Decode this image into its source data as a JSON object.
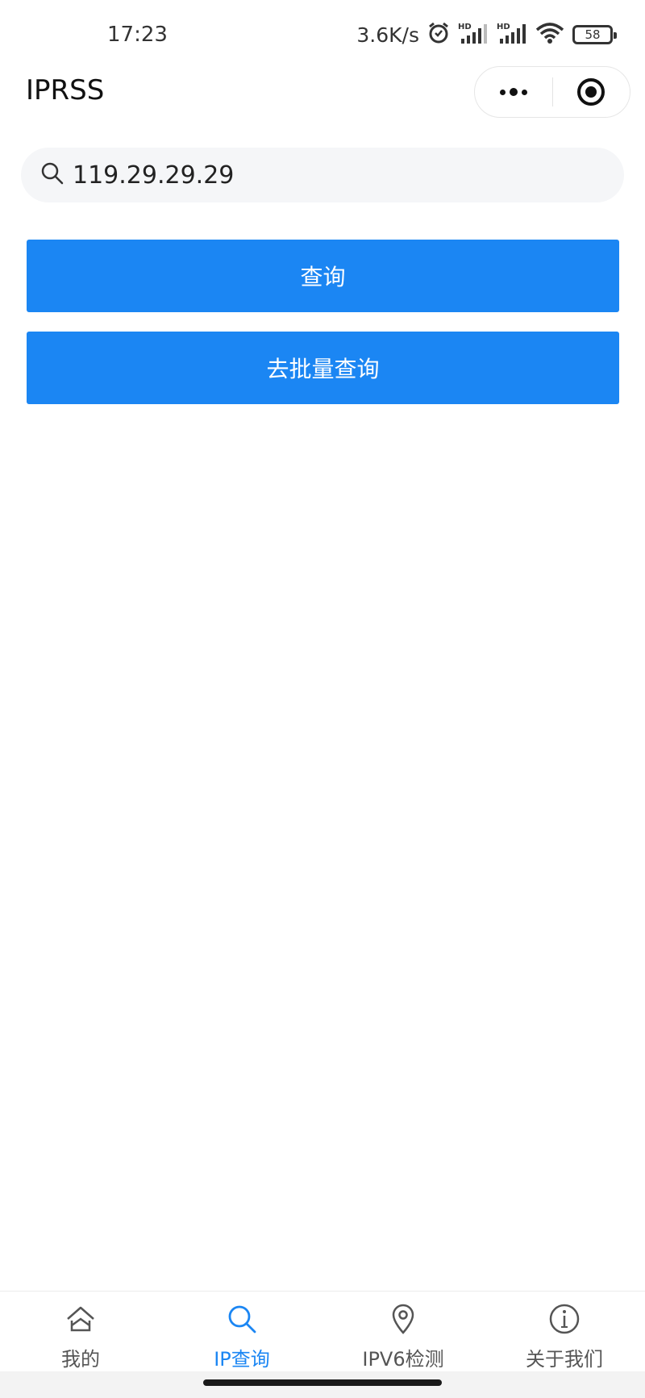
{
  "status_bar": {
    "time": "17:23",
    "speed": "3.6K/s",
    "battery": "58",
    "icons": [
      "alarm-icon",
      "hd-signal-icon",
      "hd-signal-icon",
      "wifi-icon",
      "battery-icon"
    ]
  },
  "nav": {
    "title": "IPRSS"
  },
  "search": {
    "value": "119.29.29.29",
    "icon": "search-icon"
  },
  "buttons": {
    "query": "查询",
    "batch": "去批量查询"
  },
  "colors": {
    "accent": "#1b86f3",
    "search_bg": "#f5f6f8",
    "tab_inactive": "#555555"
  },
  "tabbar": {
    "items": [
      {
        "label": "我的",
        "icon": "home-icon",
        "active": false
      },
      {
        "label": "IP查询",
        "icon": "search-icon",
        "active": true
      },
      {
        "label": "IPV6检测",
        "icon": "location-pin-icon",
        "active": false
      },
      {
        "label": "关于我们",
        "icon": "info-icon",
        "active": false
      }
    ]
  }
}
